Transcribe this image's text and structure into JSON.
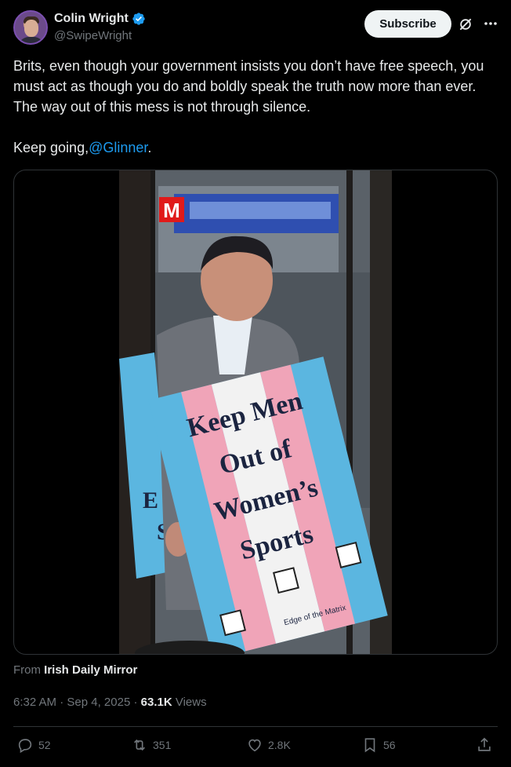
{
  "author": {
    "name": "Colin Wright",
    "handle": "@SwipeWright",
    "verified_color": "#1d9bf0"
  },
  "header": {
    "subscribe_label": "Subscribe",
    "grok_icon": "grok-icon",
    "more_icon": "more-icon"
  },
  "tweet": {
    "paragraph1": "Brits, even though your government insists you don’t have free speech, you must act as though you do and boldly speak the truth now more than ever. The way out of this mess is not through silence.",
    "paragraph2_prefix": "Keep going,",
    "mention": "@Glinner",
    "paragraph2_suffix": "."
  },
  "media": {
    "sign_lines": [
      "Keep Men",
      "Out of",
      "Women’s",
      "Sports"
    ],
    "sign_footer": "Edge of the Matrix",
    "watermark": "M",
    "side_sign_letters": [
      "E",
      "S"
    ]
  },
  "source": {
    "prefix": "From",
    "name": "Irish Daily Mirror"
  },
  "meta": {
    "time": "6:32 AM",
    "sep1": "·",
    "date": "Sep 4, 2025",
    "sep2": "·",
    "views_count": "63.1K",
    "views_label": "Views"
  },
  "actions": {
    "replies": "52",
    "reposts": "351",
    "likes": "2.8K",
    "bookmarks": "56"
  }
}
